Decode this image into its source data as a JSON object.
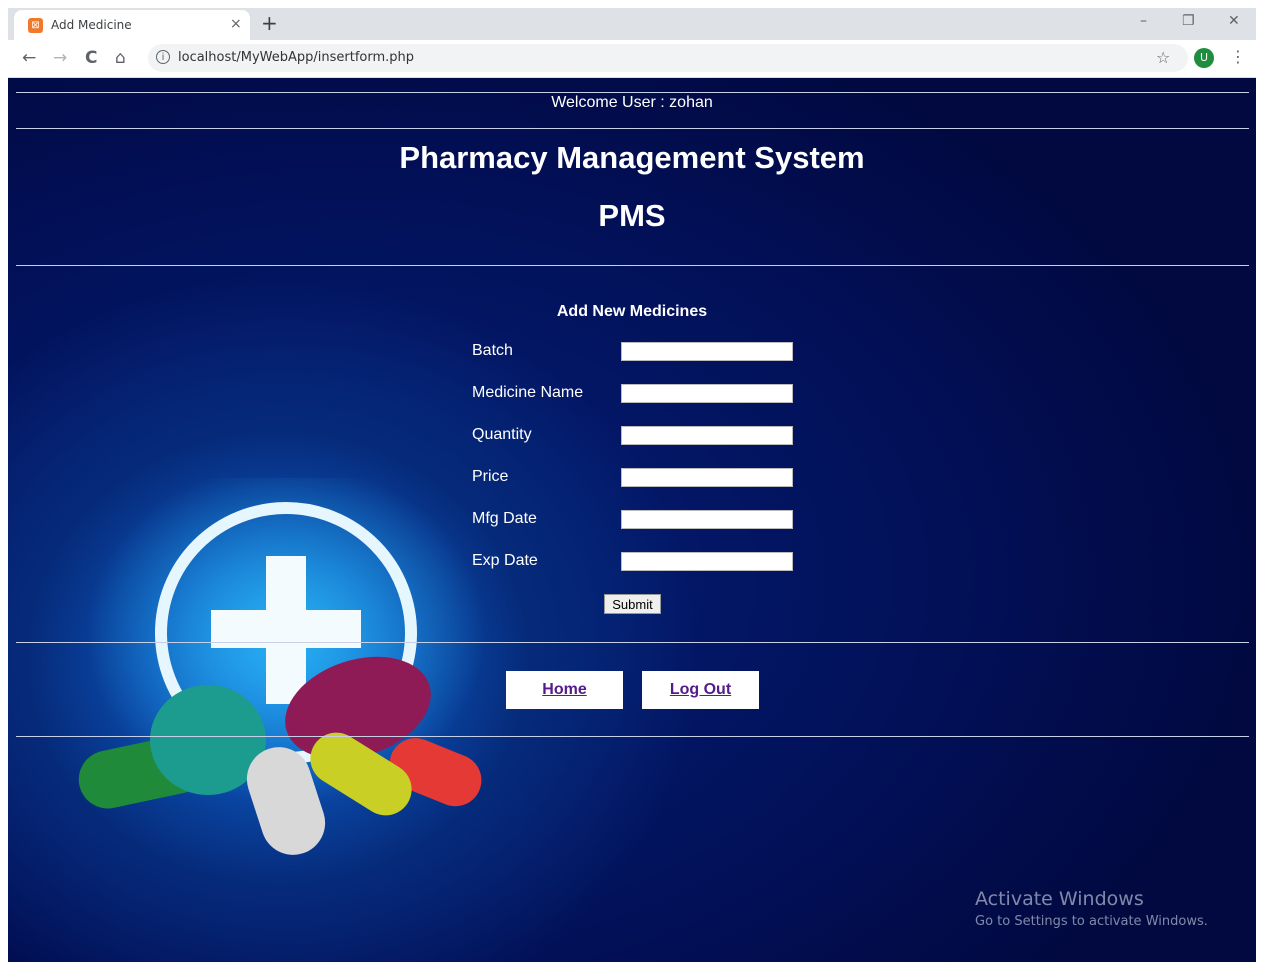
{
  "browser": {
    "tab_title": "Add Medicine",
    "tab_favicon_glyph": "⊠",
    "tab_close": "×",
    "new_tab": "+",
    "window_controls": {
      "minimize": "–",
      "restore": "❐",
      "close": "✕"
    },
    "toolbar": {
      "back": "←",
      "forward": "→",
      "reload": "C",
      "home": "⌂",
      "info": "i",
      "bookmark": "☆",
      "menu": "⋮"
    },
    "url": "localhost/MyWebApp/insertform.php",
    "profile_initial": "U",
    "profile_color": "#1e8e3e"
  },
  "header": {
    "welcome": "Welcome User : zohan",
    "title": "Pharmacy Management System",
    "subtitle": "PMS"
  },
  "form": {
    "heading": "Add New Medicines",
    "fields": [
      {
        "label": "Batch",
        "value": ""
      },
      {
        "label": "Medicine Name",
        "value": ""
      },
      {
        "label": "Quantity",
        "value": ""
      },
      {
        "label": "Price",
        "value": ""
      },
      {
        "label": "Mfg Date",
        "value": ""
      },
      {
        "label": "Exp Date",
        "value": ""
      }
    ],
    "submit_label": "Submit"
  },
  "nav": {
    "home_label": "Home",
    "logout_label": "Log Out",
    "link_color": "#551a8b"
  },
  "watermark": {
    "line1": "Activate Windows",
    "line2": "Go to Settings to activate Windows."
  },
  "background_art": {
    "icons": [
      "medical-cross-icon",
      "pills-illustration"
    ],
    "colors": {
      "page_bg": "#020f55",
      "glow": "#1a7ee0"
    }
  }
}
